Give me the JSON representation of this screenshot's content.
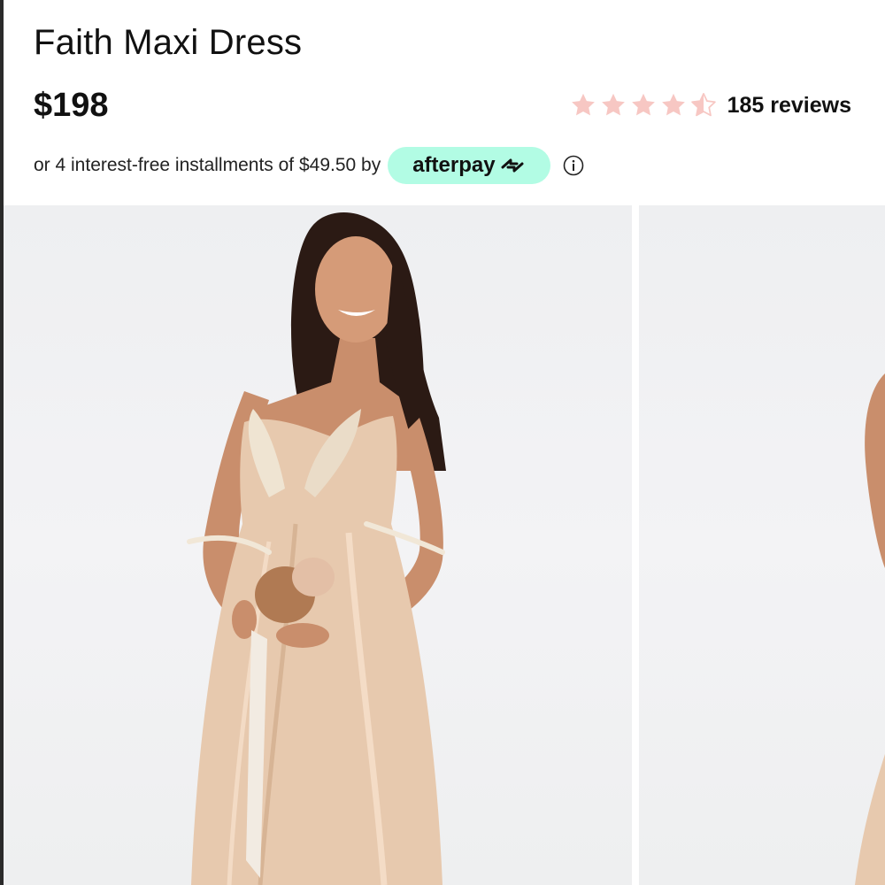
{
  "product": {
    "title": "Faith Maxi Dress",
    "price": "$198"
  },
  "rating": {
    "value": 4.5,
    "max": 5,
    "reviews_label": "185 reviews",
    "star_color": "#f7c7c3"
  },
  "payment": {
    "installments_text": "or 4 interest-free installments of $49.50 by",
    "provider_label": "afterpay",
    "provider_color": "#b2fce4",
    "logo_icon": "afterpay-arrows-icon",
    "info_icon": "info-circle-icon"
  },
  "gallery": {
    "images": [
      {
        "name": "product-image-1"
      },
      {
        "name": "product-image-2"
      }
    ]
  }
}
